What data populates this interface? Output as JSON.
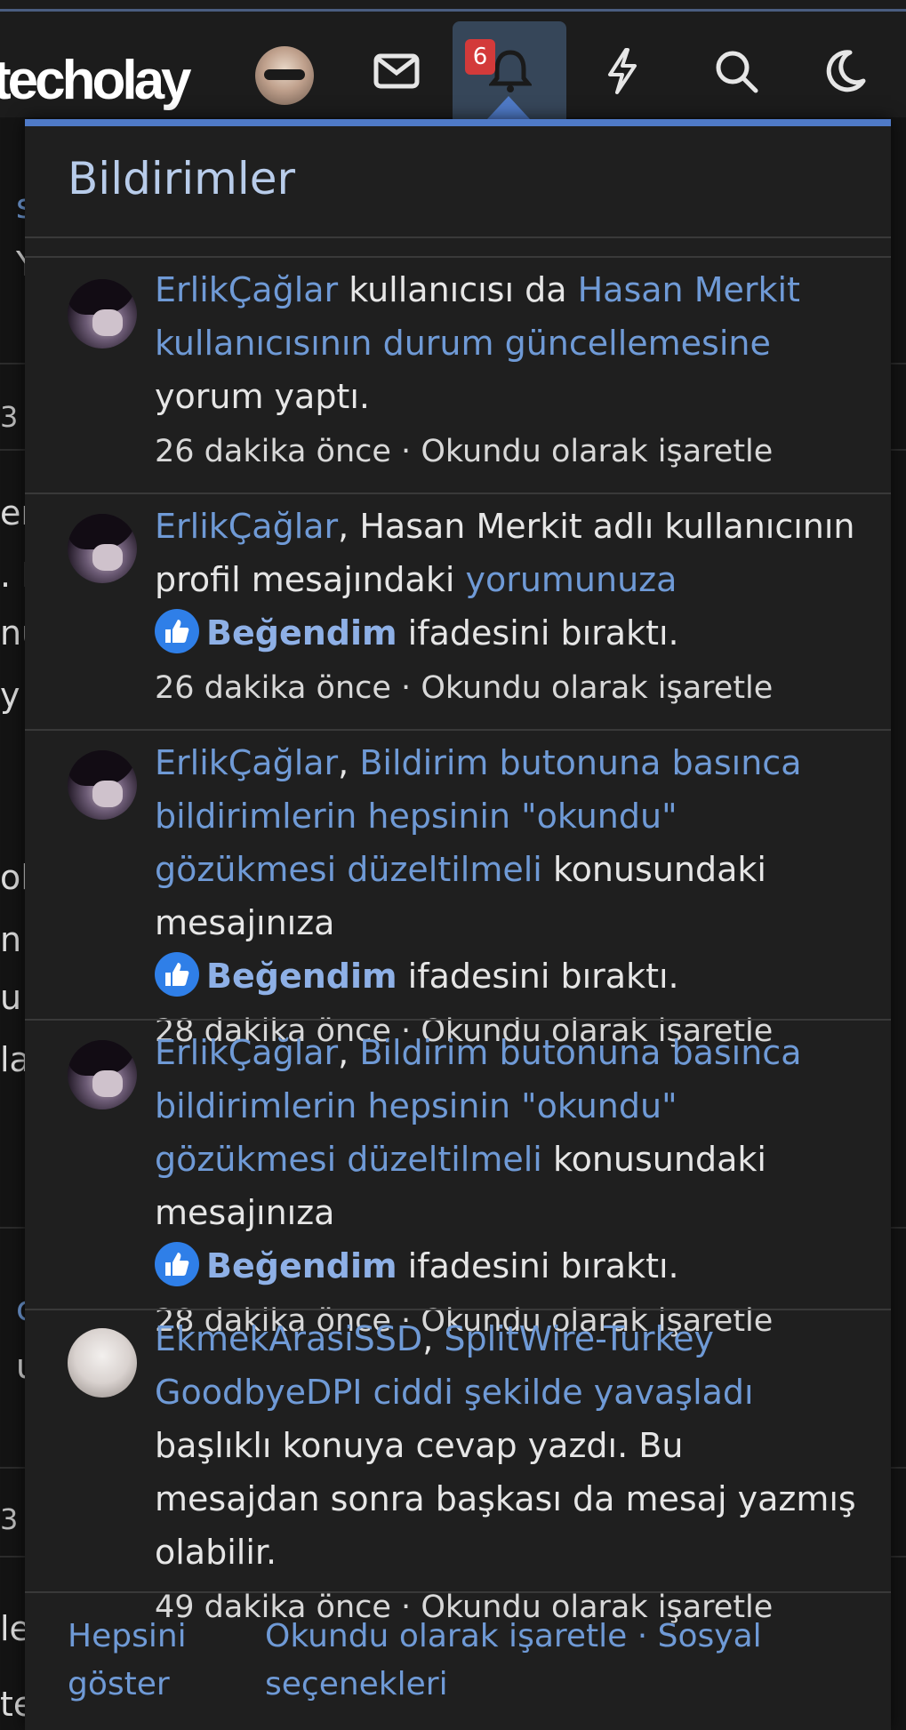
{
  "header": {
    "logo_text": "techolay",
    "notification_count": "6"
  },
  "popup": {
    "title": "Bildirimler",
    "notifications": [
      {
        "user": "ErlikÇağlar",
        "t1": " kullanıcısı da ",
        "link": "Hasan Merkit kullanıcısının durum güncellemesine",
        "t2": " yorum yaptı.",
        "time": "26 dakika önce",
        "sep": " · ",
        "mark": "Okundu olarak işaretle"
      },
      {
        "user": "ErlikÇağlar",
        "t1": ", Hasan Merkit adlı kullanıcının profil mesajındaki ",
        "link": "yorumunuza",
        "reaction": "Beğendim",
        "t2": " ifadesini bıraktı.",
        "time": "26 dakika önce",
        "sep": " · ",
        "mark": "Okundu olarak işaretle"
      },
      {
        "user": "ErlikÇağlar",
        "t1": ", ",
        "link": "Bildirim butonuna basınca bildirimlerin hepsinin \"okundu\" gözükmesi düzeltilmeli",
        "t2": " konusundaki mesajınıza ",
        "reaction": "Beğendim",
        "t3": " ifadesini bıraktı.",
        "time": "28 dakika önce",
        "sep": " · ",
        "mark": "Okundu olarak işaretle"
      },
      {
        "user": "ErlikÇağlar",
        "t1": ", ",
        "link": "Bildirim butonuna basınca bildirimlerin hepsinin \"okundu\" gözükmesi düzeltilmeli",
        "t2": " konusundaki mesajınıza ",
        "reaction": "Beğendim",
        "t3": " ifadesini bıraktı.",
        "time": "28 dakika önce",
        "sep": " · ",
        "mark": "Okundu olarak işaretle"
      },
      {
        "user": "EkmekArasiSSD",
        "t1": ", ",
        "link": "SplitWire-Turkey GoodbyeDPI ciddi şekilde yavaşladı",
        "t2": " başlıklı konuya cevap yazdı. Bu mesajdan sonra başkası da mesaj yazmış olabilir.",
        "time": "49 dakika önce",
        "sep": " · ",
        "mark": "Okundu olarak işaretle"
      }
    ],
    "footer": {
      "show_all": "Hepsini göster",
      "mark_all": "Okundu olarak işaretle",
      "sep": " · ",
      "social": "Sosyal seçenekleri"
    }
  },
  "background_fragments": [
    "s",
    "Y",
    "3",
    "er",
    ". I",
    "nü",
    " y",
    "ol",
    "n",
    "u",
    "la",
    "c",
    "u",
    "3",
    "le",
    "te"
  ]
}
